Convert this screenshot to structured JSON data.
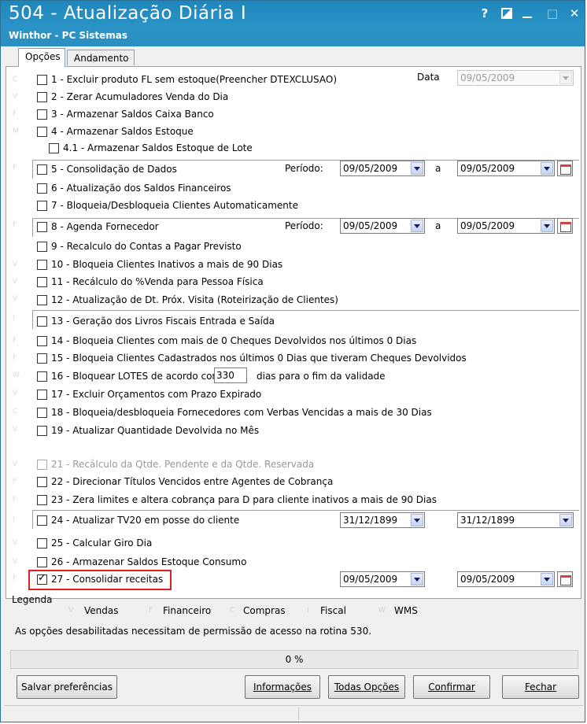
{
  "window": {
    "title": "504 - Atualização Diária I",
    "subtitle": "Winthor - PC Sistemas",
    "help_glyph": "?",
    "maximize_glyph": "□",
    "close_glyph": "✕"
  },
  "tabs": [
    {
      "label": "Opções",
      "active": true
    },
    {
      "label": "Andamento",
      "active": false
    }
  ],
  "options": {
    "o1": {
      "label": "1 - Excluir produto FL sem estoque(Preencher DTEXCLUSAO)",
      "checked": false
    },
    "o2": {
      "label": "2 - Zerar Acumuladores Venda do Dia",
      "checked": false
    },
    "o3": {
      "label": "3 - Armazenar Saldos Caixa Banco",
      "checked": false
    },
    "o4": {
      "label": "4 - Armazenar Saldos Estoque",
      "checked": false
    },
    "o41": {
      "label": "4.1 - Armazenar Saldos Estoque de Lote",
      "checked": false
    },
    "o5": {
      "label": "5 - Consolidação de Dados",
      "checked": false
    },
    "o6": {
      "label": "6 - Atualização dos Saldos Financeiros",
      "checked": false
    },
    "o7": {
      "label": "7 - Bloqueia/Desbloqueia Clientes Automaticamente",
      "checked": false
    },
    "o8": {
      "label": "8 - Agenda Fornecedor",
      "checked": false
    },
    "o9": {
      "label": "9 - Recalculo do Contas a Pagar Previsto",
      "checked": false
    },
    "o10": {
      "label": "10 - Bloqueia Clientes Inativos a mais de 90 Dias",
      "checked": false
    },
    "o11": {
      "label": "11 - Recálculo do %Venda para Pessoa Física",
      "checked": false
    },
    "o12": {
      "label": "12 - Atualização de Dt. Próx. Visita (Roteirização de Clientes)",
      "checked": false
    },
    "o13": {
      "label": "13 - Geração dos Livros Fiscais Entrada e Saída",
      "checked": false
    },
    "o14": {
      "label": "14 - Bloqueia Clientes com mais de 0 Cheques Devolvidos nos últimos 0  Dias",
      "checked": false
    },
    "o15": {
      "label": "15 - Bloqueia Clientes Cadastrados nos últimos 0 Dias que tiveram Cheques Devolvidos",
      "checked": false
    },
    "o16": {
      "label": "16 - Bloquear LOTES de acordo com",
      "suffix": "dias para o fim da validade",
      "days": "330",
      "checked": false
    },
    "o17": {
      "label": "17 - Excluir Orçamentos com Prazo Expirado",
      "checked": false
    },
    "o18": {
      "label": "18 - Bloqueia/desbloqueia Fornecedores com Verbas Vencidas a mais de 30 Dias",
      "checked": false
    },
    "o19": {
      "label": "19 - Atualizar Quantidade Devolvida no Mês",
      "checked": false
    },
    "o21": {
      "label": "21 - Recálculo da Qtde. Pendente e da Qtde. Reservada",
      "checked": false,
      "disabled": true
    },
    "o22": {
      "label": "22 - Direcionar Títulos Vencidos entre Agentes de Cobrança",
      "checked": false
    },
    "o23": {
      "label": "23 - Zera limites e altera cobrança para D  para cliente inativos a mais de 90 Dias",
      "checked": false
    },
    "o24": {
      "label": "24 - Atualizar TV20 em posse do cliente",
      "checked": false
    },
    "o25": {
      "label": "25 - Calcular Giro Dia",
      "checked": false
    },
    "o26": {
      "label": "26 - Armazenar Saldos Estoque Consumo",
      "checked": false
    },
    "o27": {
      "label": "27 - Consolidar receitas",
      "checked": true
    }
  },
  "fields": {
    "data_label": "Data",
    "data_value": "09/05/2009",
    "periodo_label": "Período:",
    "a_label": "a",
    "o5_from": "09/05/2009",
    "o5_to": "09/05/2009",
    "o8_from": "09/05/2009",
    "o8_to": "09/05/2009",
    "o24_from": "31/12/1899",
    "o24_to": "31/12/1899",
    "o27_from": "09/05/2009",
    "o27_to": "09/05/2009"
  },
  "legend": {
    "title": "Legenda",
    "items": [
      {
        "letter": "V",
        "label": "Vendas"
      },
      {
        "letter": "F",
        "label": "Financeiro"
      },
      {
        "letter": "C",
        "label": "Compras"
      },
      {
        "letter": "I",
        "label": "Fiscal"
      },
      {
        "letter": "W",
        "label": "WMS"
      }
    ]
  },
  "notice": "As opções desabilitadas necessitam de permissão de acesso na rotina 530.",
  "progress": {
    "value": 0,
    "text": "0 %"
  },
  "buttons": {
    "save_prefs": "Salvar preferências",
    "info": "Informações",
    "all_options": "Todas Opções",
    "confirm": "Confirmar",
    "close": "Fechar"
  },
  "row_letters": {
    "o1": "C",
    "o2": "V",
    "o3": "F",
    "o4": "M",
    "o5": "F",
    "o8": "F",
    "o10": "V",
    "o11": "V",
    "o12": "V",
    "o13": "I",
    "o14": "F",
    "o15": "F",
    "o16": "W",
    "o17": "V",
    "o18": "C",
    "o19": "V",
    "o21": "V",
    "o22": "F",
    "o23": "F",
    "o24": "I",
    "o25": "V",
    "o26": "V",
    "o27": "F"
  },
  "colors": {
    "titlebar": "#2a93c6",
    "highlight": "#e02020"
  }
}
